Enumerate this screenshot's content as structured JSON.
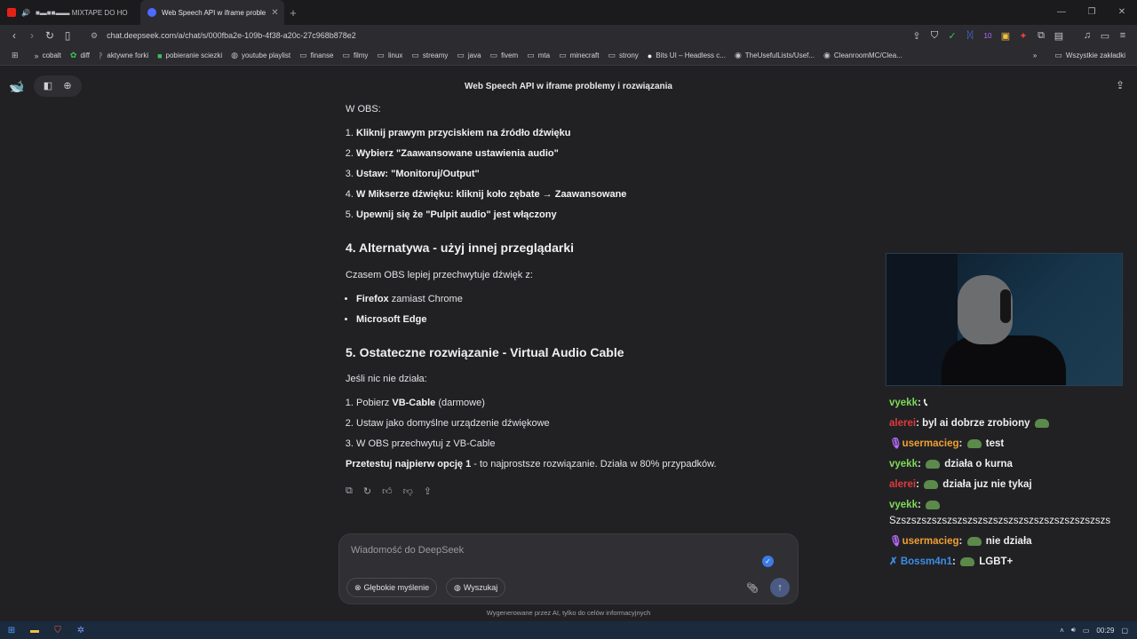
{
  "browser": {
    "tabs": [
      {
        "label": "■▬■■▬▬ MIXTAPE DO HO",
        "active": false
      },
      {
        "label": "Web Speech API w iframe proble",
        "active": true
      }
    ],
    "url": "chat.deepseek.com/a/chat/s/000fba2e-109b-4f38-a20c-27c968b878e2",
    "bookmarks": [
      "cobalt",
      "diff",
      "aktywne forki",
      "pobieranie sciezki",
      "youtube playlist",
      "finanse",
      "filmy",
      "linux",
      "streamy",
      "java",
      "fivem",
      "mta",
      "minecraft",
      "strony",
      "Bits UI – Headless c...",
      "TheUsefulLists/Usef...",
      "CleanroomMC/Clea..."
    ],
    "bookmarks_other": "Wszystkie zakładki",
    "extension_badge": "10"
  },
  "chat": {
    "title": "Web Speech API w iframe problemy i rozwiązania",
    "obs_intro": "W OBS:",
    "obs_steps": [
      "Kliknij prawym przyciskiem na źródło dźwięku",
      "Wybierz \"Zaawansowane ustawienia audio\"",
      "Ustaw: \"Monitoruj/Output\"",
      "W Mikserze dźwięku: kliknij koło zębate → Zaawansowane",
      "Upewnij się że \"Pulpit audio\" jest włączony"
    ],
    "section4_title": "4. Alternatywa - użyj innej przeglądarki",
    "section4_text": "Czasem OBS lepiej przechwytuje dźwięk z:",
    "browsers": [
      {
        "bold": "Firefox",
        "rest": " zamiast Chrome"
      },
      {
        "bold": "Microsoft Edge",
        "rest": ""
      }
    ],
    "section5_title": "5. Ostateczne rozwiązanie - Virtual Audio Cable",
    "section5_text": "Jeśli nic nie działa:",
    "vac_steps": [
      {
        "pre": "Pobierz ",
        "bold": "VB-Cable",
        "post": " (darmowe)"
      },
      {
        "pre": "Ustaw jako domyślne urządzenie dźwiękowe",
        "bold": "",
        "post": ""
      },
      {
        "pre": "W OBS przechwytuj z VB-Cable",
        "bold": "",
        "post": ""
      }
    ],
    "final_bold": "Przetestuj najpierw opcję 1",
    "final_rest": " - to najprostsze rozwiązanie. Działa w 80% przypadków.",
    "composer_placeholder": "Wiadomość do DeepSeek",
    "deep_think_label": "Głębokie myślenie",
    "search_label": "Wyszukaj",
    "disclaimer": "Wygenerowane przez AI, tylko do celów informacyjnych"
  },
  "stream_chat": [
    {
      "user": "vyekk",
      "color": "#7ed957",
      "text": "",
      "icon": ""
    },
    {
      "user": "alerei",
      "color": "#e03a3a",
      "text": "byl ai dobrze zrobiony",
      "icon": ""
    },
    {
      "user": "usermacieg",
      "color": "#f0a030",
      "text": "test",
      "icon": "🎙"
    },
    {
      "user": "vyekk",
      "color": "#7ed957",
      "text": "działa o kurna",
      "icon": ""
    },
    {
      "user": "alerei",
      "color": "#e03a3a",
      "text": "działa juz nie tykaj",
      "icon": ""
    },
    {
      "user": "vyekk",
      "color": "#7ed957",
      "text": "",
      "icon": ""
    },
    {
      "user": "",
      "color": "#efefef",
      "text": "Szszszszszszszszszszszszszszszszszszszszszs",
      "icon": ""
    },
    {
      "user": "usermacieg",
      "color": "#f0a030",
      "text": "nie działa",
      "icon": "🎙"
    },
    {
      "user": "Bossm4n1",
      "color": "#3a8ee6",
      "text": "LGBT+",
      "icon": "✗"
    }
  ],
  "taskbar": {
    "time": "00:29"
  },
  "colors": {
    "accent": "#4d6bfe",
    "send_button": "#4a5a82"
  }
}
